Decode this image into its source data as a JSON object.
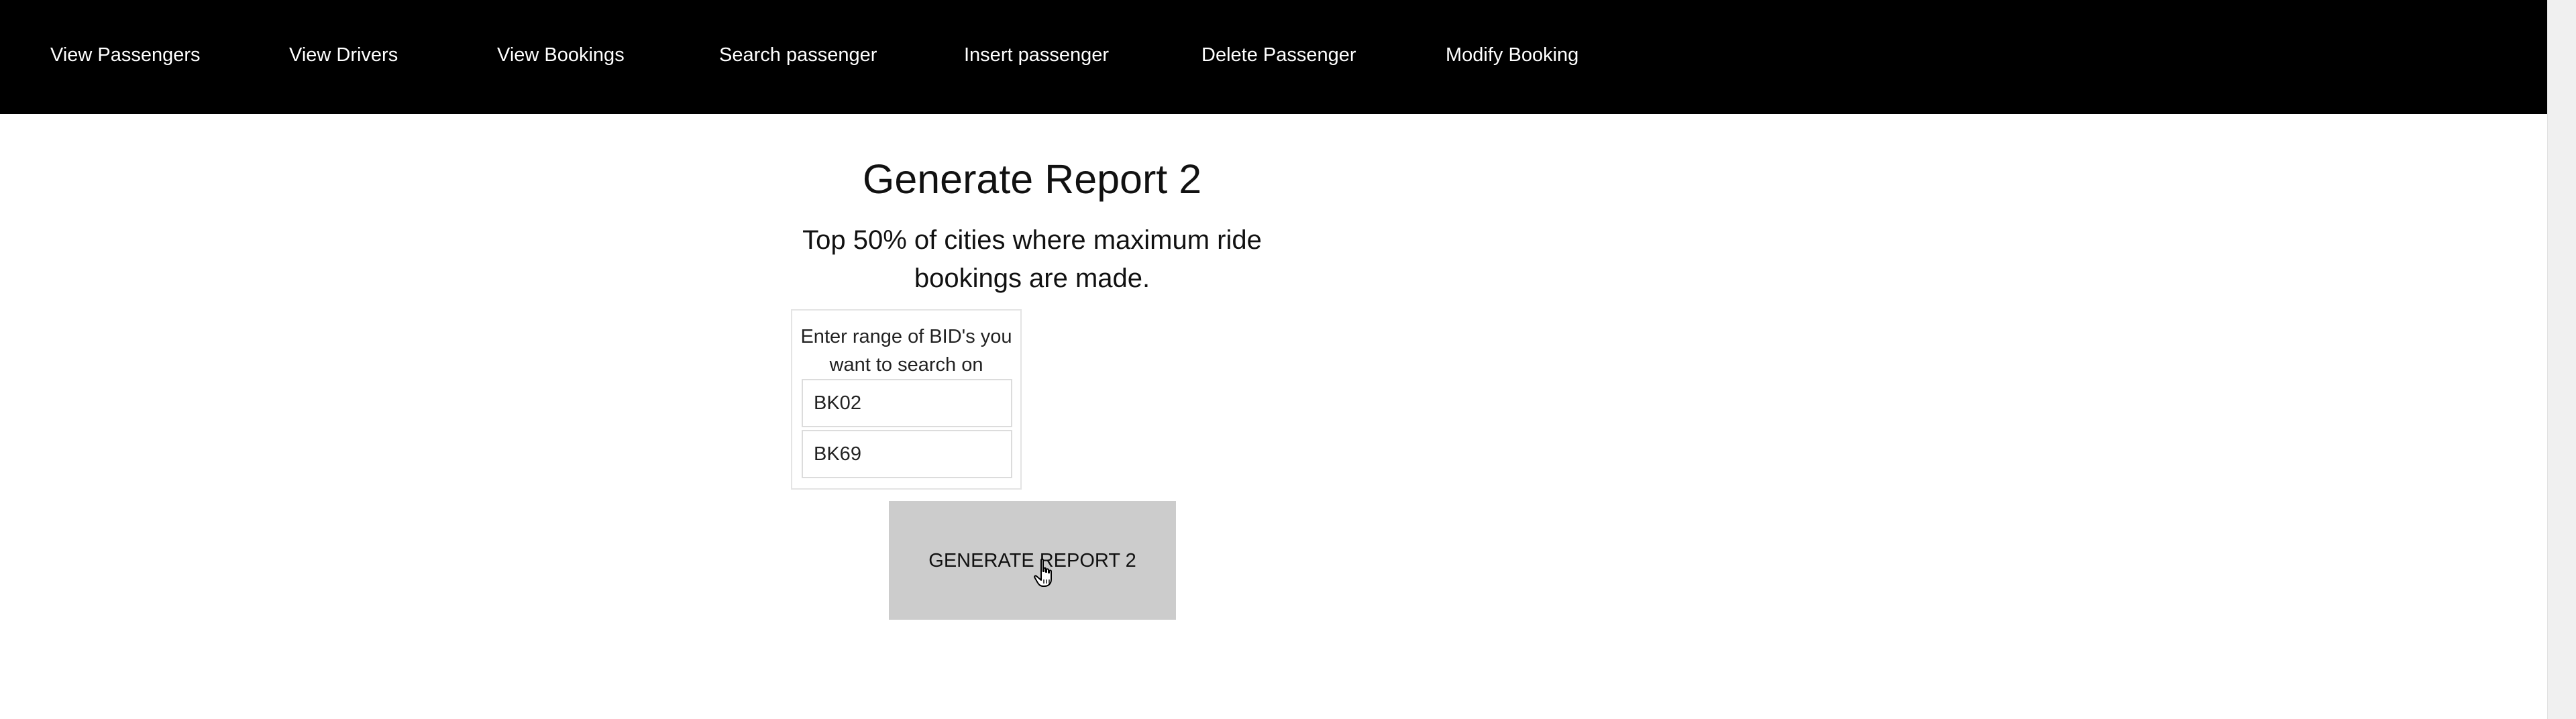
{
  "nav": {
    "items": [
      {
        "label": "View Passengers"
      },
      {
        "label": "View Drivers"
      },
      {
        "label": "View Bookings"
      },
      {
        "label": "Search passenger"
      },
      {
        "label": "Insert passenger"
      },
      {
        "label": "Delete Passenger"
      },
      {
        "label": "Modify Booking"
      }
    ]
  },
  "report": {
    "title": "Generate Report 2",
    "subtitle": "Top 50% of cities where maximum ride bookings are made."
  },
  "form": {
    "label": "Enter range of BID's you want to search on",
    "bid_from": "BK02",
    "bid_to": "BK69",
    "submit_label": "GENERATE REPORT 2"
  },
  "icons": {
    "cursor": "hand-pointer-icon"
  },
  "colors": {
    "nav_background": "#000000",
    "nav_text": "#ffffff",
    "button_background": "#cccccc"
  }
}
